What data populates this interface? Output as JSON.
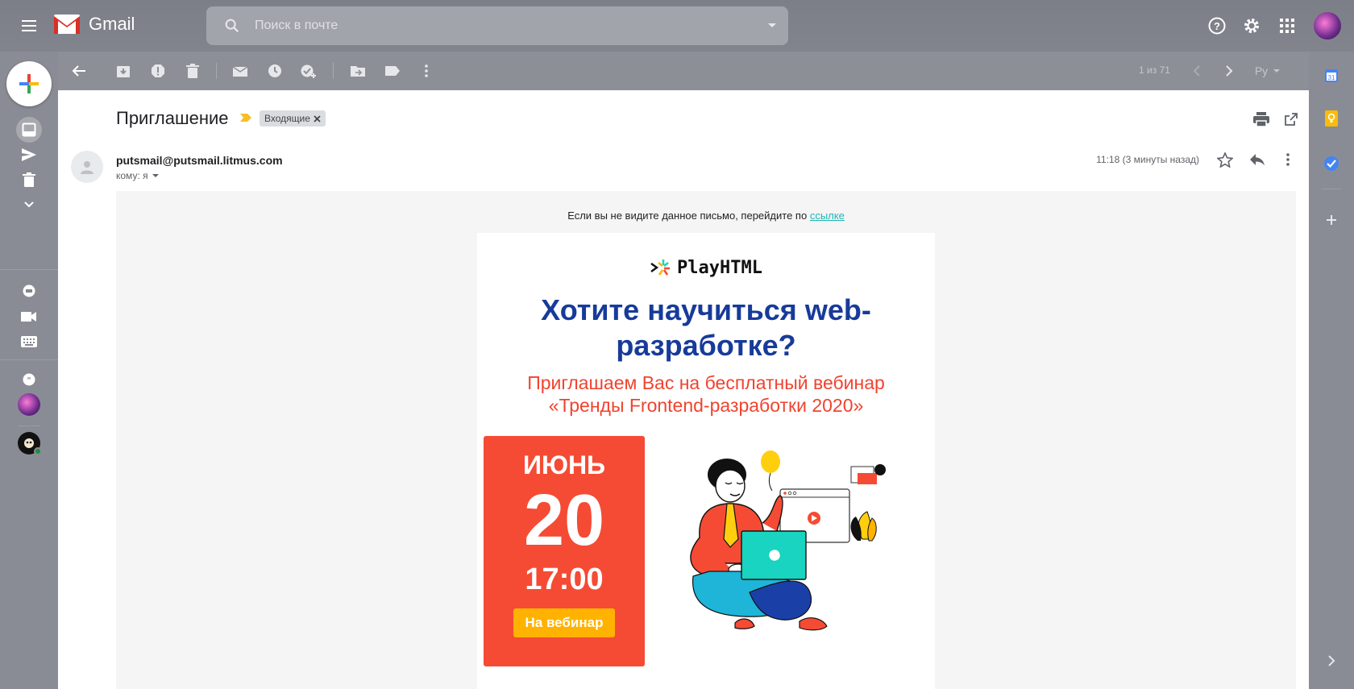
{
  "app": {
    "name": "Gmail"
  },
  "search": {
    "placeholder": "Поиск в почте"
  },
  "toolbar": {
    "pagination": "1 из 71",
    "language": "Ру"
  },
  "message": {
    "subject": "Приглашение",
    "label": "Входящие",
    "sender": "putsmail@putsmail.litmus.com",
    "to": "кому: я",
    "time": "11:18 (3 минуты назад)"
  },
  "email": {
    "notice_text": "Если вы не видите данное письмо, перейдите по ",
    "notice_link": "ссылке",
    "brand": "PlayHTML",
    "headline_line1": "Хотите научиться web-",
    "headline_line2": "разработке?",
    "subline_line1": "Приглашаем Вас на бесплатный вебинар",
    "subline_line2": "«Тренды Frontend-разработки 2020»",
    "month": "ИЮНЬ",
    "day": "20",
    "time": "17:00",
    "cta": "На вебинар"
  },
  "rightpanel": {
    "calendar_day": "31"
  },
  "colors": {
    "headline": "#173b9a",
    "accent_red": "#f54b34",
    "cta": "#ffb300",
    "link": "#1fb5b5",
    "laptop": "#18d4c0"
  }
}
